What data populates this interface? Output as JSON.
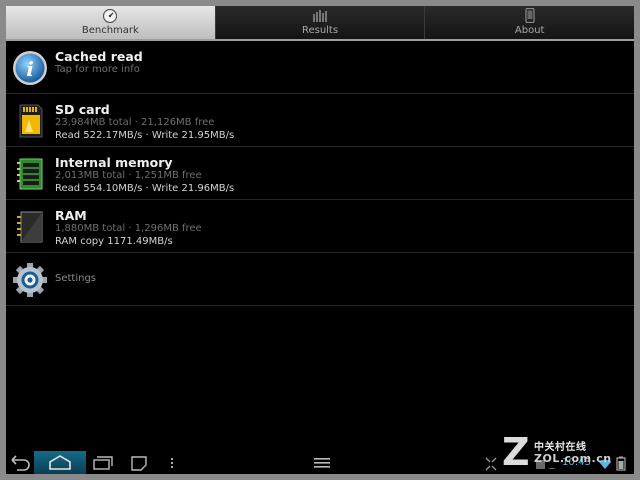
{
  "tabs": [
    {
      "label": "Benchmark",
      "icon": "gauge-icon",
      "active": true
    },
    {
      "label": "Results",
      "icon": "bar-chart-icon",
      "active": false
    },
    {
      "label": "About",
      "icon": "phone-icon",
      "active": false
    }
  ],
  "rows": {
    "cached": {
      "title": "Cached read",
      "sub": "Tap for more info"
    },
    "sd": {
      "title": "SD card",
      "sub": "23,984MB total · 21,126MB free",
      "detail": "Read 522.17MB/s · Write 21.95MB/s"
    },
    "internal": {
      "title": "Internal memory",
      "sub": "2,013MB total · 1,251MB free",
      "detail": "Read 554.10MB/s · Write 21.96MB/s"
    },
    "ram": {
      "title": "RAM",
      "sub": "1,880MB total · 1,296MB free",
      "detail": "RAM copy 1171.49MB/s"
    },
    "settings": {
      "title": "Settings"
    }
  },
  "status": {
    "time": "10:43"
  },
  "watermark": {
    "text": "中关村在线",
    "url": "ZOL.com.cn"
  },
  "colors": {
    "accent": "#5ab7e0",
    "active_tab": "#d6d6d6",
    "background": "#000000"
  }
}
